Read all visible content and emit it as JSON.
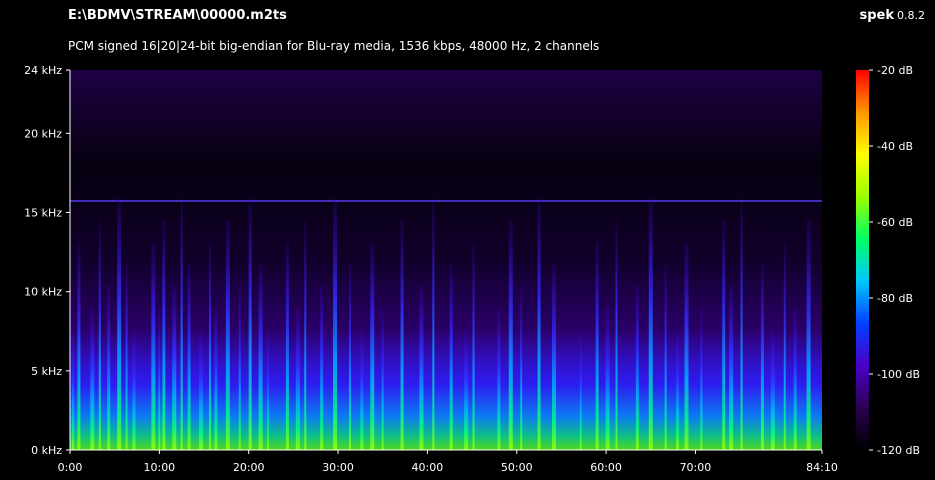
{
  "header": {
    "file_path": "E:\\BDMV\\STREAM\\00000.m2ts",
    "app_name": "spek",
    "app_version": "0.8.2",
    "stream_info": "PCM signed 16|20|24-bit big-endian for Blu-ray media, 1536 kbps, 48000 Hz, 2 channels"
  },
  "chart_data": {
    "type": "heatmap",
    "title": "",
    "xlabel": "",
    "ylabel": "",
    "x_unit": "min:sec",
    "x_ticks": [
      {
        "value": 0,
        "label": "0:00"
      },
      {
        "value": 600,
        "label": "10:00"
      },
      {
        "value": 1200,
        "label": "20:00"
      },
      {
        "value": 1800,
        "label": "30:00"
      },
      {
        "value": 2400,
        "label": "40:00"
      },
      {
        "value": 3000,
        "label": "50:00"
      },
      {
        "value": 3600,
        "label": "60:00"
      },
      {
        "value": 4200,
        "label": "70:00"
      },
      {
        "value": 5050,
        "label": "84:10"
      }
    ],
    "xlim": [
      0,
      5050
    ],
    "y_ticks": [
      {
        "value": 0,
        "label": "0 kHz"
      },
      {
        "value": 5,
        "label": "5 kHz"
      },
      {
        "value": 10,
        "label": "10 kHz"
      },
      {
        "value": 15,
        "label": "15 kHz"
      },
      {
        "value": 20,
        "label": "20 kHz"
      },
      {
        "value": 24,
        "label": "24 kHz"
      }
    ],
    "ylim": [
      0,
      24
    ],
    "colorbar": {
      "range": [
        -120,
        -20
      ],
      "ticks": [
        {
          "value": -20,
          "label": "-20 dB"
        },
        {
          "value": -40,
          "label": "-40 dB"
        },
        {
          "value": -60,
          "label": "-60 dB"
        },
        {
          "value": -80,
          "label": "-80 dB"
        },
        {
          "value": -100,
          "label": "-100 dB"
        },
        {
          "value": -120,
          "label": "-120 dB"
        }
      ],
      "colors": [
        "#000000",
        "#2a0050",
        "#4b00c8",
        "#0040ff",
        "#00c8ff",
        "#00ff64",
        "#9bff00",
        "#ffff00",
        "#ff9600",
        "#ff0000"
      ]
    },
    "transients_sec": [
      20,
      60,
      150,
      200,
      260,
      330,
      380,
      430,
      560,
      600,
      630,
      700,
      750,
      800,
      880,
      940,
      980,
      1060,
      1140,
      1210,
      1280,
      1330,
      1460,
      1530,
      1580,
      1690,
      1780,
      1880,
      1960,
      2030,
      2100,
      2230,
      2360,
      2440,
      2560,
      2660,
      2710,
      2880,
      2960,
      3030,
      3150,
      3250,
      3430,
      3540,
      3610,
      3670,
      3810,
      3900,
      4000,
      4080,
      4140,
      4240,
      4390,
      4440,
      4510,
      4650,
      4720,
      4800,
      4870,
      4960
    ]
  }
}
